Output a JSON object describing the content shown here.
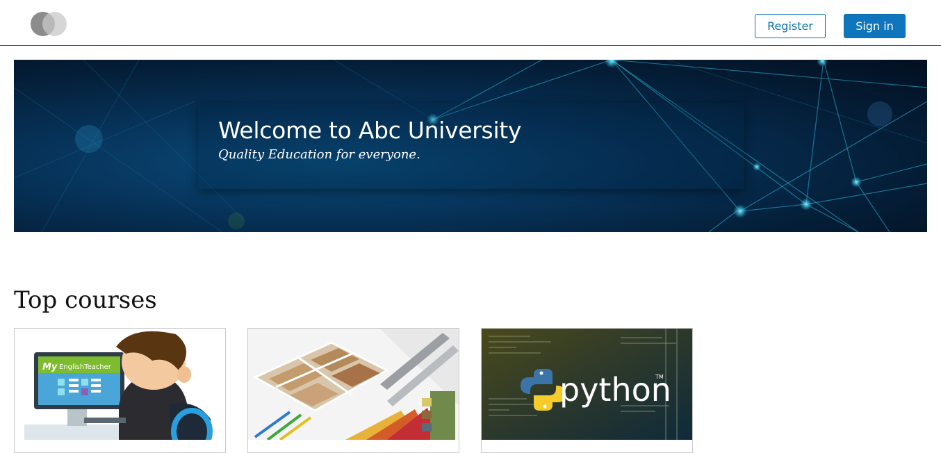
{
  "header": {
    "logo_icon": "two-circles-logo-icon",
    "register_label": "Register",
    "signin_label": "Sign in",
    "accent_color": "#0f75bc"
  },
  "hero": {
    "title": "Welcome to Abc University",
    "subtitle": "Quality Education for everyone."
  },
  "courses": {
    "heading": "Top courses",
    "items": [
      {
        "thumbnail_text": "EnglishTeacher",
        "thumbnail_logo": "My"
      },
      {
        "thumbnail_text": ""
      },
      {
        "thumbnail_text": "python",
        "thumbnail_mark": "TM"
      }
    ]
  }
}
